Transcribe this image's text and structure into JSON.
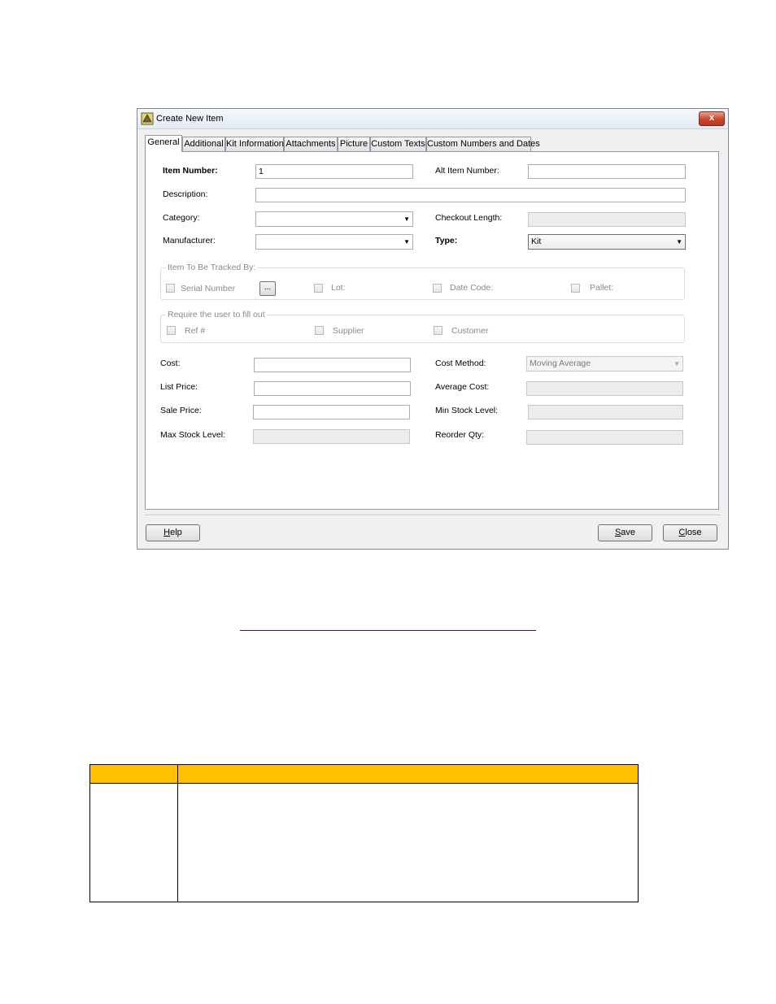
{
  "window": {
    "title": "Create New Item",
    "close_label": "x"
  },
  "tabs": [
    {
      "label": "General",
      "active": true
    },
    {
      "label": "Additional"
    },
    {
      "label": "Kit Information"
    },
    {
      "label": "Attachments"
    },
    {
      "label": "Picture"
    },
    {
      "label": "Custom Texts"
    },
    {
      "label": "Custom Numbers and Dates"
    }
  ],
  "form": {
    "item_number": {
      "label": "Item Number:",
      "value": "1"
    },
    "alt_item_number": {
      "label": "Alt Item Number:",
      "value": ""
    },
    "description": {
      "label": "Description:",
      "value": ""
    },
    "category": {
      "label": "Category:",
      "value": ""
    },
    "checkout_length": {
      "label": "Checkout Length:",
      "value": ""
    },
    "manufacturer": {
      "label": "Manufacturer:",
      "value": ""
    },
    "type": {
      "label": "Type:",
      "value": "Kit"
    },
    "tracked_group": {
      "title": "Item To Be Tracked By:",
      "serial_number": "Serial Number",
      "ellipsis": "...",
      "lot": "Lot:",
      "date_code": "Date Code:",
      "pallet": "Pallet:"
    },
    "require_group": {
      "title": "Require the user to fill out",
      "ref": "Ref #",
      "supplier": "Supplier",
      "customer": "Customer"
    },
    "cost": {
      "label": "Cost:",
      "value": ""
    },
    "cost_method": {
      "label": "Cost Method:",
      "value": "Moving Average"
    },
    "list_price": {
      "label": "List Price:",
      "value": ""
    },
    "average_cost": {
      "label": "Average Cost:",
      "value": ""
    },
    "sale_price": {
      "label": "Sale Price:",
      "value": ""
    },
    "min_stock_level": {
      "label": "Min Stock Level:",
      "value": ""
    },
    "max_stock_level": {
      "label": "Max Stock Level:",
      "value": ""
    },
    "reorder_qty": {
      "label": "Reorder Qty:",
      "value": ""
    }
  },
  "buttons": {
    "help_first": "H",
    "help_rest": "elp",
    "save_first": "S",
    "save_rest": "ave",
    "close_first": "C",
    "close_rest": "lose"
  },
  "colors": {
    "table_header": "#ffc000",
    "link_underline": "#1a1aa8"
  }
}
